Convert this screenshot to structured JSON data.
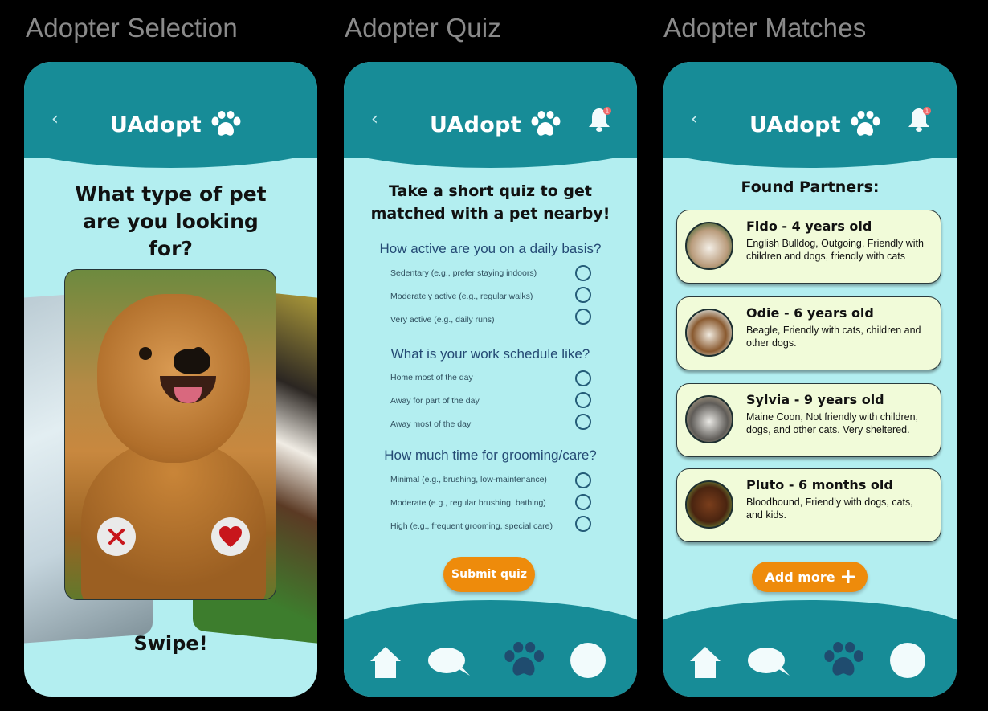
{
  "colors": {
    "teal": "#178c97",
    "background": "#b3eef0",
    "accent_orange": "#ee8b0b",
    "card_bg": "#f1fbd9"
  },
  "screens": {
    "selection": {
      "frame_title": "Adopter Selection",
      "app_name": "UAdopt",
      "question": "What type of pet are you looking for?",
      "swipe_label": "Swipe!",
      "icons": [
        "back-chevron-icon",
        "paw-logo-icon",
        "reject-x-icon",
        "heart-like-icon"
      ]
    },
    "quiz": {
      "frame_title": "Adopter Quiz",
      "app_name": "UAdopt",
      "title_line1": "Take a short quiz to get",
      "title_line2": "matched with a pet nearby!",
      "questions": [
        {
          "heading": "How active are you on a daily basis?",
          "options": [
            "Sedentary (e.g., prefer staying indoors)",
            "Moderately active (e.g., regular walks)",
            "Very active (e.g., daily runs)"
          ]
        },
        {
          "heading": "What is your work schedule like?",
          "options": [
            "Home most of the day",
            "Away for part of the day",
            "Away most of the day"
          ]
        },
        {
          "heading": "How much time for grooming/care?",
          "options": [
            "Minimal (e.g., brushing, low-maintenance)",
            "Moderate (e.g., regular brushing, bathing)",
            "High (e.g., frequent grooming, special care)"
          ]
        }
      ],
      "submit_label": "Submit quiz",
      "notification_badge": "1"
    },
    "matches": {
      "frame_title": "Adopter Matches",
      "app_name": "UAdopt",
      "title": "Found Partners:",
      "partners": [
        {
          "name": "Fido - 4 years old",
          "description": "English Bulldog, Outgoing, Friendly with children and dogs, friendly with cats"
        },
        {
          "name": "Odie - 6 years old",
          "description": "Beagle, Friendly with cats, children and other dogs."
        },
        {
          "name": "Sylvia - 9 years old",
          "description": "Maine Coon, Not friendly with children, dogs, and other cats. Very sheltered."
        },
        {
          "name": "Pluto - 6 months old",
          "description": "Bloodhound, Friendly with dogs, cats, and kids."
        }
      ],
      "add_more_label": "Add more",
      "notification_badge": "1"
    }
  },
  "bottom_nav": [
    "home-icon",
    "chat-bubble-icon",
    "paw-icon",
    "profile-icon"
  ]
}
